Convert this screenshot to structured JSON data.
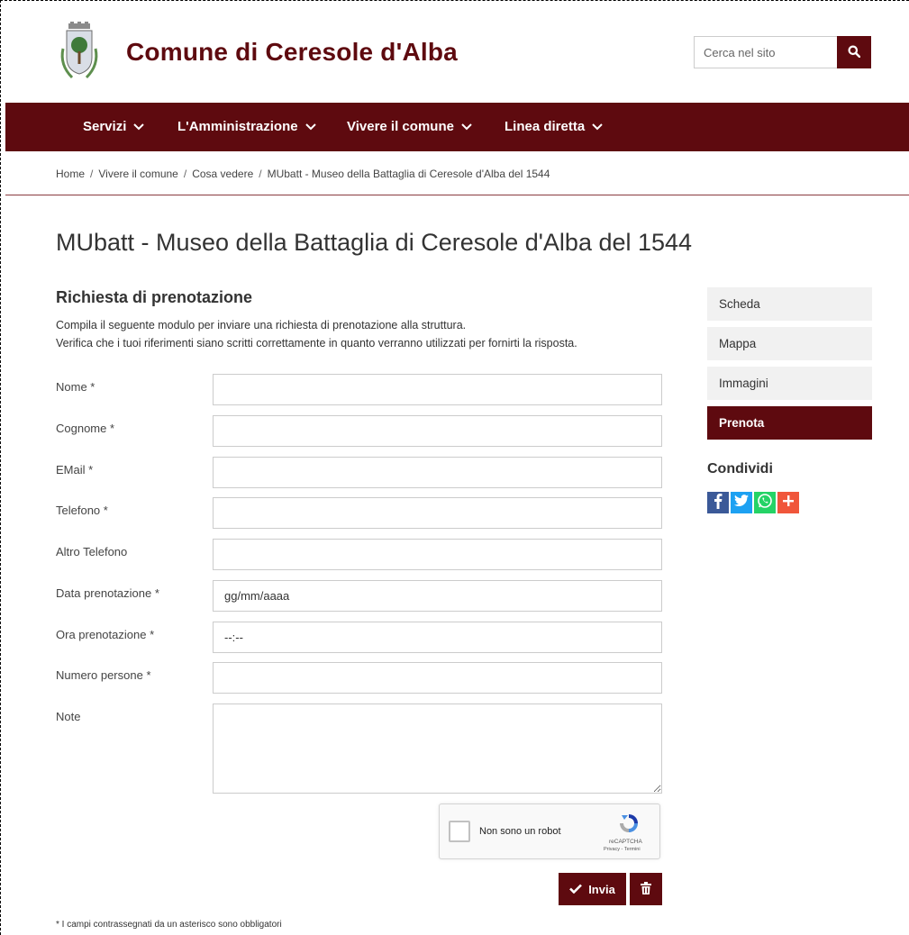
{
  "header": {
    "site_title": "Comune di Ceresole d'Alba",
    "search_placeholder": "Cerca nel sito"
  },
  "nav": {
    "items": [
      {
        "label": "Servizi"
      },
      {
        "label": "L'Amministrazione"
      },
      {
        "label": "Vivere il comune"
      },
      {
        "label": "Linea diretta"
      }
    ]
  },
  "breadcrumb": {
    "items": [
      "Home",
      "Vivere il comune",
      "Cosa vedere",
      "MUbatt - Museo della Battaglia di Ceresole d'Alba del 1544"
    ],
    "separator": "/"
  },
  "page": {
    "title": "MUbatt - Museo della Battaglia di Ceresole d'Alba del 1544"
  },
  "form": {
    "title": "Richiesta di prenotazione",
    "intro_line1": "Compila il seguente modulo per inviare una richiesta di prenotazione alla struttura.",
    "intro_line2": "Verifica che i tuoi riferimenti siano scritti correttamente in quanto verranno utilizzati per fornirti la risposta.",
    "fields": {
      "nome": "Nome *",
      "cognome": "Cognome *",
      "email": "EMail *",
      "telefono": "Telefono *",
      "altro_telefono": "Altro Telefono",
      "data": "Data prenotazione *",
      "data_value": "gg/mm/aaaa",
      "ora": "Ora prenotazione *",
      "ora_value": "--:--",
      "persone": "Numero persone *",
      "note": "Note"
    },
    "recaptcha": {
      "label": "Non sono un robot",
      "brand": "reCAPTCHA",
      "terms": "Privacy - Termini"
    },
    "send_label": "Invia",
    "footnote": "* I campi contrassegnati da un asterisco sono obbligatori"
  },
  "sidebar": {
    "items": [
      {
        "label": "Scheda"
      },
      {
        "label": "Mappa"
      },
      {
        "label": "Immagini"
      },
      {
        "label": "Prenota"
      }
    ],
    "share_title": "Condividi"
  },
  "colors": {
    "brand": "#5e0a0f",
    "facebook": "#3b5998",
    "twitter": "#1da1f2",
    "whatsapp": "#25d366",
    "more": "#f0563b"
  }
}
